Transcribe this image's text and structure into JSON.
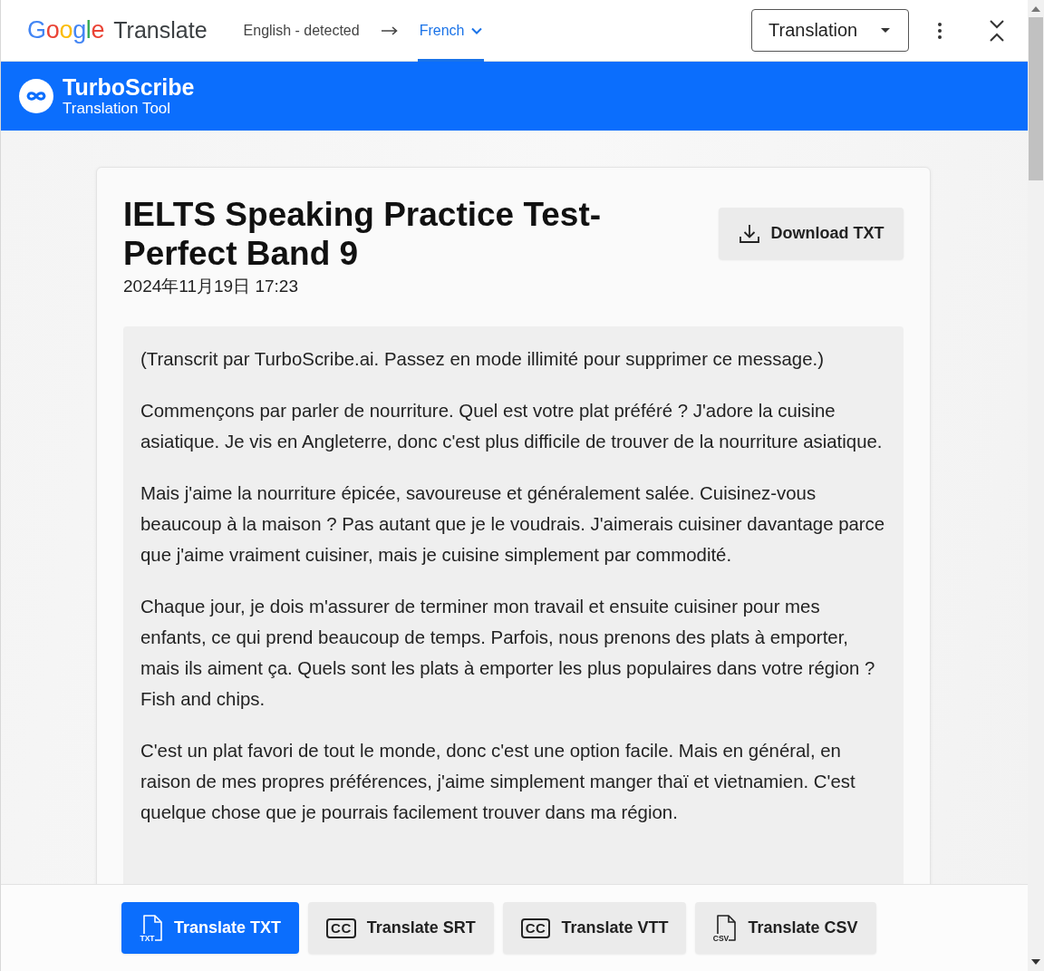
{
  "translate_bar": {
    "logo": "Google",
    "title": "Translate",
    "languages": [
      {
        "label": "English - detected",
        "selected": false,
        "kind": "source"
      },
      {
        "label": "French",
        "selected": true,
        "kind": "target"
      }
    ],
    "mode_dropdown": {
      "value": "Translation"
    }
  },
  "banner": {
    "title": "TurboScribe",
    "subtitle": "Translation Tool"
  },
  "document": {
    "title": "IELTS Speaking Practice Test-Perfect Band 9",
    "date": "2024年11月19日 17:23",
    "download_button": "Download TXT",
    "paragraphs": [
      "(Transcrit par TurboScribe.ai. Passez en mode illimité pour supprimer ce message.)",
      "Commençons par parler de nourriture. Quel est votre plat préféré ? J'adore la cuisine asiatique. Je vis en Angleterre, donc c'est plus difficile de trouver de la nourriture asiatique.",
      "Mais j'aime la nourriture épicée, savoureuse et généralement salée. Cuisinez-vous beaucoup à la maison ? Pas autant que je le voudrais. J'aimerais cuisiner davantage parce que j'aime vraiment cuisiner, mais je cuisine simplement par commodité.",
      "Chaque jour, je dois m'assurer de terminer mon travail et ensuite cuisiner pour mes enfants, ce qui prend beaucoup de temps. Parfois, nous prenons des plats à emporter, mais ils aiment ça. Quels sont les plats à emporter les plus populaires dans votre région ? Fish and chips.",
      "C'est un plat favori de tout le monde, donc c'est une option facile. Mais en général, en raison de mes propres préférences, j'aime simplement manger thaï et vietnamien. C'est quelque chose que je pourrais facilement trouver dans ma région."
    ]
  },
  "footer": {
    "buttons": [
      {
        "label": "Translate TXT",
        "selected": true,
        "kind": "file",
        "icon_label": "TXT"
      },
      {
        "label": "Translate SRT",
        "selected": false,
        "kind": "captions",
        "icon_label": "CC"
      },
      {
        "label": "Translate VTT",
        "selected": false,
        "kind": "captions",
        "icon_label": "CC"
      },
      {
        "label": "Translate CSV",
        "selected": false,
        "kind": "file",
        "icon_label": "CSV"
      }
    ]
  }
}
